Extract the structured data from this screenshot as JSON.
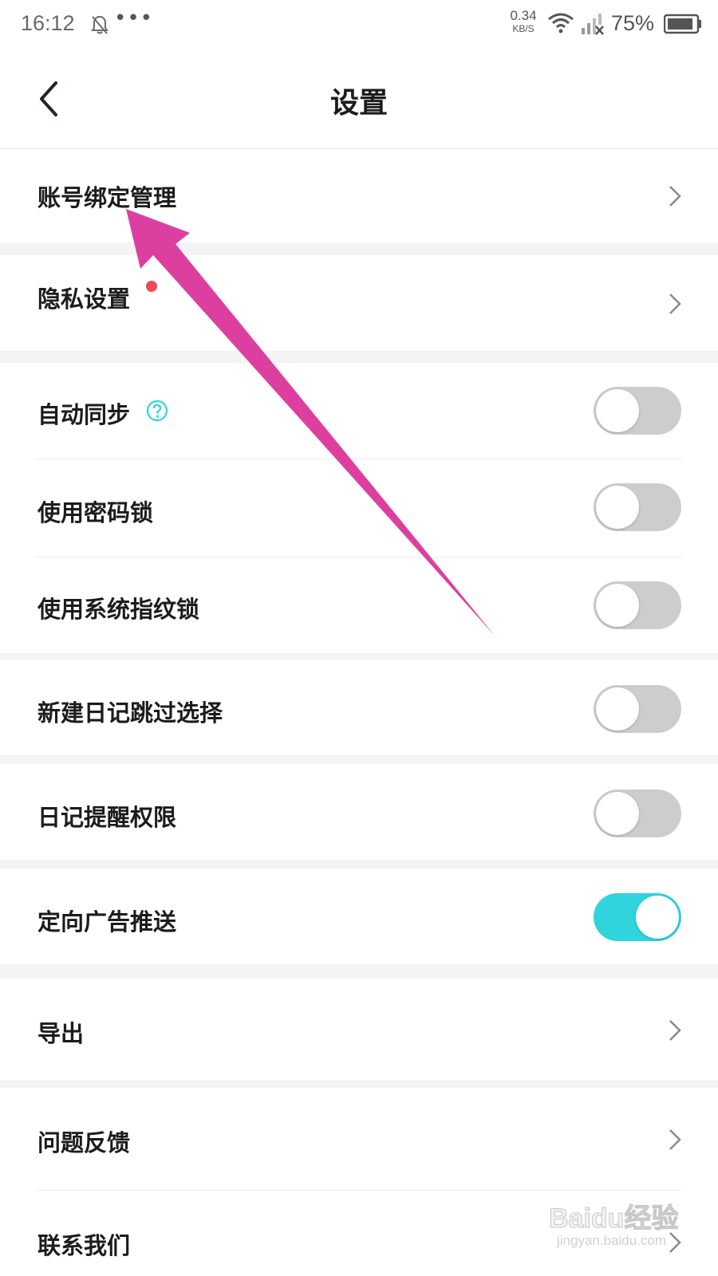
{
  "status_bar": {
    "time": "16:12",
    "dots": "•••",
    "net_speed_value": "0.34",
    "net_speed_unit": "KB/S",
    "battery_percent": "75%",
    "icons": [
      "bell-off-icon",
      "wifi-icon",
      "signal-icon",
      "battery-icon"
    ]
  },
  "header": {
    "title": "设置",
    "back_icon": "chevron-left-icon"
  },
  "settings": {
    "account_binding": "账号绑定管理",
    "privacy": "隐私设置",
    "auto_sync": "自动同步",
    "password_lock": "使用密码锁",
    "fingerprint_lock": "使用系统指纹锁",
    "skip_selection": "新建日记跳过选择",
    "diary_reminder": "日记提醒权限",
    "targeted_ads": "定向广告推送",
    "export": "导出",
    "feedback": "问题反馈",
    "contact_us": "联系我们"
  },
  "toggles": {
    "auto_sync": false,
    "password_lock": false,
    "fingerprint_lock": false,
    "skip_selection": false,
    "diary_reminder": false,
    "targeted_ads": true
  },
  "colors": {
    "accent": "#2fd4dd",
    "toggle_off": "#cdcdcd",
    "badge_red": "#f04a55",
    "annotation_arrow": "#dd3fa0"
  },
  "watermark": {
    "brand": "Baidu经验",
    "url": "jingyan.baidu.com"
  }
}
